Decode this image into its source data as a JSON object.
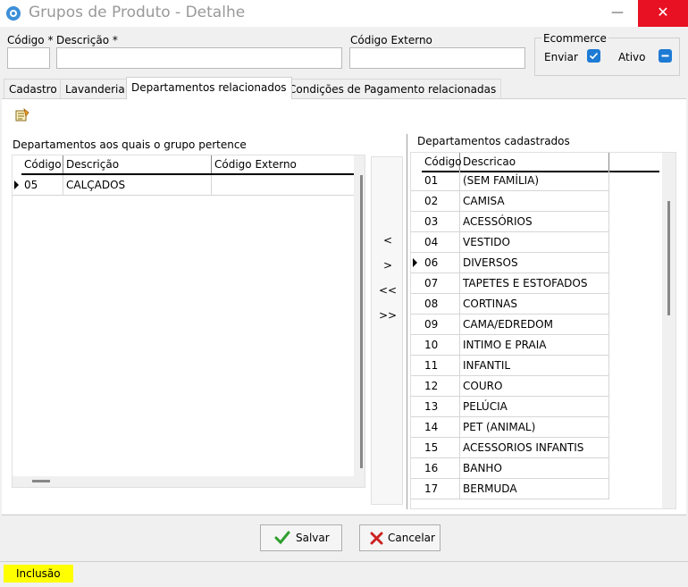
{
  "window": {
    "title": "Grupos de Produto - Detalhe",
    "minimize": "—",
    "close": "✕"
  },
  "form": {
    "codigo_label": "Código *",
    "descricao_label": "Descrição *",
    "codigo_externo_label": "Código Externo",
    "codigo_value": "",
    "descricao_value": "",
    "codigo_externo_value": ""
  },
  "ecommerce": {
    "title": "Ecommerce",
    "enviar_label": "Enviar",
    "ativo_label": "Ativo",
    "enviar_checked": true,
    "ativo_checked": true
  },
  "tabs": [
    {
      "label": "Cadastro",
      "active": false
    },
    {
      "label": "Lavanderia",
      "active": false
    },
    {
      "label": "Departamentos relacionados",
      "active": true
    },
    {
      "label": "Condições de Pagamento relacionadas",
      "active": false
    }
  ],
  "left_grid": {
    "title": "Departamentos aos quais o grupo pertence",
    "columns": [
      "Código",
      "Descrição",
      "Código Externo"
    ],
    "rows": [
      {
        "codigo": "05",
        "descricao": "CALÇADOS",
        "externo": ""
      }
    ]
  },
  "move_buttons": [
    "<",
    ">",
    "<<",
    ">>"
  ],
  "right_grid": {
    "title": "Departamentos cadastrados",
    "columns": [
      "Código",
      "Descricao"
    ],
    "selected_index": 4,
    "rows": [
      {
        "codigo": "01",
        "descricao": "(SEM FAMÍLIA)"
      },
      {
        "codigo": "02",
        "descricao": "CAMISA"
      },
      {
        "codigo": "03",
        "descricao": "ACESSÓRIOS"
      },
      {
        "codigo": "04",
        "descricao": "VESTIDO"
      },
      {
        "codigo": "06",
        "descricao": "DIVERSOS"
      },
      {
        "codigo": "07",
        "descricao": "TAPETES E ESTOFADOS"
      },
      {
        "codigo": "08",
        "descricao": "CORTINAS"
      },
      {
        "codigo": "09",
        "descricao": "CAMA/EDREDOM"
      },
      {
        "codigo": "10",
        "descricao": "INTIMO E PRAIA"
      },
      {
        "codigo": "11",
        "descricao": "INFANTIL"
      },
      {
        "codigo": "12",
        "descricao": "COURO"
      },
      {
        "codigo": "13",
        "descricao": "PELÚCIA"
      },
      {
        "codigo": "14",
        "descricao": "PET (ANIMAL)"
      },
      {
        "codigo": "15",
        "descricao": "ACESSORIOS INFANTIS"
      },
      {
        "codigo": "16",
        "descricao": "BANHO"
      },
      {
        "codigo": "17",
        "descricao": "BERMUDA"
      }
    ]
  },
  "buttons": {
    "save": "Salvar",
    "cancel": "Cancelar"
  },
  "status": {
    "mode": "Inclusão"
  },
  "colors": {
    "accent": "#1e7bd4",
    "status_bg": "#ffff00",
    "save_icon": "#2e9e2e",
    "cancel_icon": "#cc2222"
  }
}
